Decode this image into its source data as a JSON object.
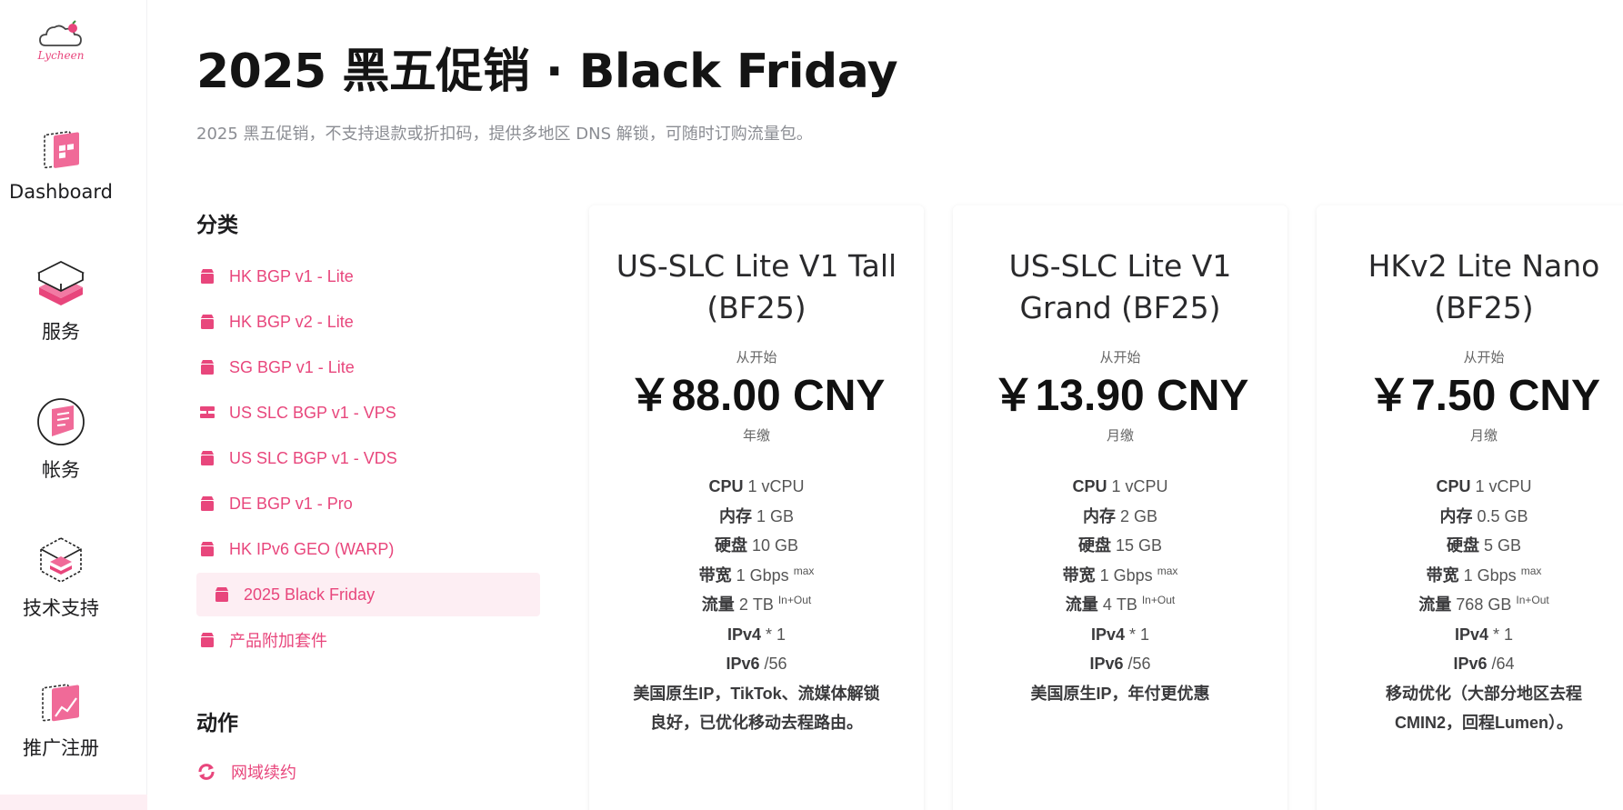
{
  "colors": {
    "accent": "#e8467c",
    "active_bg": "#fdeef3"
  },
  "brand": {
    "logo_text": "Lycheen"
  },
  "nav": [
    {
      "label": "Dashboard",
      "icon": "dashboard-icon"
    },
    {
      "label": "服务",
      "icon": "services-icon"
    },
    {
      "label": "帐务",
      "icon": "billing-icon"
    },
    {
      "label": "技术支持",
      "icon": "support-icon"
    },
    {
      "label": "推广注册",
      "icon": "affiliate-icon"
    }
  ],
  "page": {
    "title": "2025 黑五促销 · Black Friday",
    "description": "2025 黑五促销，不支持退款或折扣码，提供多地区 DNS 解锁，可随时订购流量包。"
  },
  "categories": {
    "heading": "分类",
    "items": [
      {
        "label": "HK BGP v1 - Lite",
        "icon": "box-icon"
      },
      {
        "label": "HK BGP v2 - Lite",
        "icon": "box-icon"
      },
      {
        "label": "SG BGP v1 - Lite",
        "icon": "box-icon"
      },
      {
        "label": "US SLC BGP v1 - VPS",
        "icon": "server-icon"
      },
      {
        "label": "US SLC BGP v1 - VDS",
        "icon": "box-icon"
      },
      {
        "label": "DE BGP v1 - Pro",
        "icon": "box-icon"
      },
      {
        "label": "HK IPv6 GEO (WARP)",
        "icon": "box-icon"
      },
      {
        "label": "2025 Black Friday",
        "icon": "box-icon",
        "active": true
      },
      {
        "label": "产品附加套件",
        "icon": "box-icon"
      }
    ]
  },
  "actions": {
    "heading": "动作",
    "items": [
      {
        "label": "网域续约",
        "icon": "refresh-icon"
      }
    ]
  },
  "products": [
    {
      "name": "US-SLC Lite V1 Tall (BF25)",
      "from_label": "从开始",
      "price": "￥88.00 CNY",
      "cycle": "年缴",
      "specs": {
        "cpu_label": "CPU",
        "cpu": "1 vCPU",
        "ram_label": "内存",
        "ram": "1 GB",
        "disk_label": "硬盘",
        "disk": "10 GB",
        "bw_label": "带宽",
        "bw": "1 Gbps",
        "bw_sup": "max",
        "traffic_label": "流量",
        "traffic": "2 TB",
        "traffic_sup": "In+Out",
        "ipv4_label": "IPv4",
        "ipv4": "* 1",
        "ipv6_label": "IPv6",
        "ipv6": "/56",
        "note": "美国原生IP，TikTok、流媒体解锁良好，已优化移动去程路由。"
      }
    },
    {
      "name": "US-SLC Lite V1 Grand (BF25)",
      "from_label": "从开始",
      "price": "￥13.90 CNY",
      "cycle": "月缴",
      "specs": {
        "cpu_label": "CPU",
        "cpu": "1 vCPU",
        "ram_label": "内存",
        "ram": "2 GB",
        "disk_label": "硬盘",
        "disk": "15 GB",
        "bw_label": "带宽",
        "bw": "1 Gbps",
        "bw_sup": "max",
        "traffic_label": "流量",
        "traffic": "4 TB",
        "traffic_sup": "In+Out",
        "ipv4_label": "IPv4",
        "ipv4": "* 1",
        "ipv6_label": "IPv6",
        "ipv6": "/56",
        "note": "美国原生IP，年付更优惠"
      }
    },
    {
      "name": "HKv2 Lite Nano (BF25)",
      "from_label": "从开始",
      "price": "￥7.50 CNY",
      "cycle": "月缴",
      "specs": {
        "cpu_label": "CPU",
        "cpu": "1 vCPU",
        "ram_label": "内存",
        "ram": "0.5 GB",
        "disk_label": "硬盘",
        "disk": "5 GB",
        "bw_label": "带宽",
        "bw": "1 Gbps",
        "bw_sup": "max",
        "traffic_label": "流量",
        "traffic": "768 GB",
        "traffic_sup": "In+Out",
        "ipv4_label": "IPv4",
        "ipv4": "* 1",
        "ipv6_label": "IPv6",
        "ipv6": "/64",
        "note": "移动优化（大部分地区去程CMIN2，回程Lumen）。"
      }
    }
  ]
}
